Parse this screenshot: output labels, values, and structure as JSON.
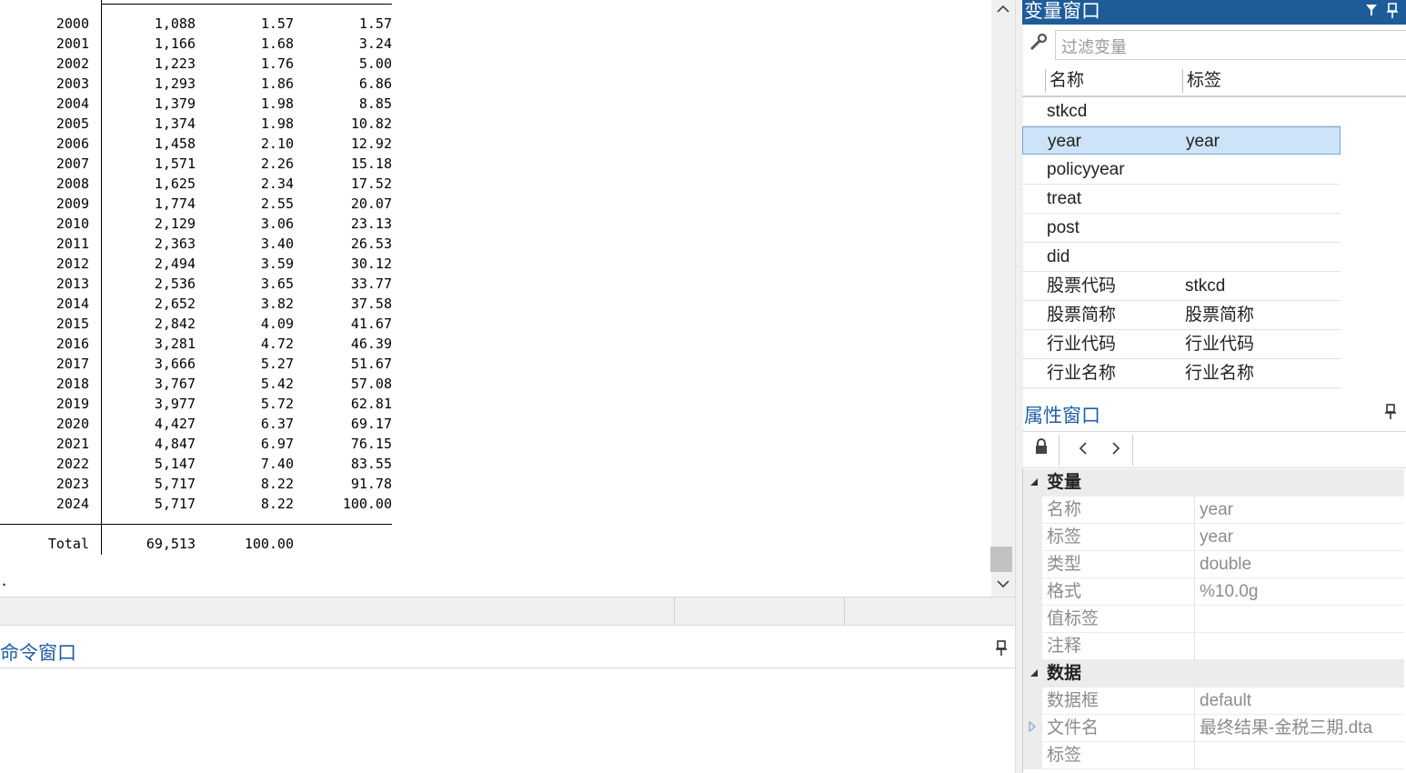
{
  "results": {
    "rows": [
      {
        "year": "2000",
        "freq": "1,088",
        "percent": "1.57",
        "cum": "1.57"
      },
      {
        "year": "2001",
        "freq": "1,166",
        "percent": "1.68",
        "cum": "3.24"
      },
      {
        "year": "2002",
        "freq": "1,223",
        "percent": "1.76",
        "cum": "5.00"
      },
      {
        "year": "2003",
        "freq": "1,293",
        "percent": "1.86",
        "cum": "6.86"
      },
      {
        "year": "2004",
        "freq": "1,379",
        "percent": "1.98",
        "cum": "8.85"
      },
      {
        "year": "2005",
        "freq": "1,374",
        "percent": "1.98",
        "cum": "10.82"
      },
      {
        "year": "2006",
        "freq": "1,458",
        "percent": "2.10",
        "cum": "12.92"
      },
      {
        "year": "2007",
        "freq": "1,571",
        "percent": "2.26",
        "cum": "15.18"
      },
      {
        "year": "2008",
        "freq": "1,625",
        "percent": "2.34",
        "cum": "17.52"
      },
      {
        "year": "2009",
        "freq": "1,774",
        "percent": "2.55",
        "cum": "20.07"
      },
      {
        "year": "2010",
        "freq": "2,129",
        "percent": "3.06",
        "cum": "23.13"
      },
      {
        "year": "2011",
        "freq": "2,363",
        "percent": "3.40",
        "cum": "26.53"
      },
      {
        "year": "2012",
        "freq": "2,494",
        "percent": "3.59",
        "cum": "30.12"
      },
      {
        "year": "2013",
        "freq": "2,536",
        "percent": "3.65",
        "cum": "33.77"
      },
      {
        "year": "2014",
        "freq": "2,652",
        "percent": "3.82",
        "cum": "37.58"
      },
      {
        "year": "2015",
        "freq": "2,842",
        "percent": "4.09",
        "cum": "41.67"
      },
      {
        "year": "2016",
        "freq": "3,281",
        "percent": "4.72",
        "cum": "46.39"
      },
      {
        "year": "2017",
        "freq": "3,666",
        "percent": "5.27",
        "cum": "51.67"
      },
      {
        "year": "2018",
        "freq": "3,767",
        "percent": "5.42",
        "cum": "57.08"
      },
      {
        "year": "2019",
        "freq": "3,977",
        "percent": "5.72",
        "cum": "62.81"
      },
      {
        "year": "2020",
        "freq": "4,427",
        "percent": "6.37",
        "cum": "69.17"
      },
      {
        "year": "2021",
        "freq": "4,847",
        "percent": "6.97",
        "cum": "76.15"
      },
      {
        "year": "2022",
        "freq": "5,147",
        "percent": "7.40",
        "cum": "83.55"
      },
      {
        "year": "2023",
        "freq": "5,717",
        "percent": "8.22",
        "cum": "91.78"
      },
      {
        "year": "2024",
        "freq": "5,717",
        "percent": "8.22",
        "cum": "100.00"
      }
    ],
    "total": {
      "label": "Total",
      "freq": "69,513",
      "percent": "100.00"
    },
    "prompt": "."
  },
  "command_window": {
    "title": "命令窗口"
  },
  "variables_window": {
    "title": "变量窗口",
    "filter_placeholder": "过滤变量",
    "columns": {
      "name": "名称",
      "label": "标签"
    },
    "variables": [
      {
        "name": "stkcd",
        "label": ""
      },
      {
        "name": "year",
        "label": "year",
        "selected": true
      },
      {
        "name": "policyyear",
        "label": ""
      },
      {
        "name": "treat",
        "label": ""
      },
      {
        "name": "post",
        "label": ""
      },
      {
        "name": "did",
        "label": ""
      },
      {
        "name": "股票代码",
        "label": "stkcd"
      },
      {
        "name": "股票简称",
        "label": "股票简称"
      },
      {
        "name": "行业代码",
        "label": "行业代码"
      },
      {
        "name": "行业名称",
        "label": "行业名称"
      }
    ]
  },
  "properties_window": {
    "title": "属性窗口",
    "sections": [
      {
        "label": "变量",
        "rows": [
          {
            "key": "名称",
            "value": "year"
          },
          {
            "key": "标签",
            "value": "year"
          },
          {
            "key": "类型",
            "value": "double"
          },
          {
            "key": "格式",
            "value": "%10.0g"
          },
          {
            "key": "值标签",
            "value": ""
          },
          {
            "key": "注释",
            "value": ""
          }
        ]
      },
      {
        "label": "数据",
        "rows": [
          {
            "key": "数据框",
            "value": "default"
          },
          {
            "key": "文件名",
            "value": "最终结果-金税三期.dta"
          },
          {
            "key": "标签",
            "value": ""
          }
        ]
      }
    ]
  },
  "icons": {
    "scroll_up": "chevron-up-icon",
    "scroll_down": "chevron-down-icon",
    "pin": "pin-icon",
    "filter": "filter-icon",
    "wrench": "wrench-icon",
    "lock": "lock-icon",
    "back": "chevron-left-icon",
    "forward": "chevron-right-icon",
    "collapse": "triangle-collapse-icon"
  },
  "colors": {
    "title_bar": "#1e5c99",
    "title_text": "#1f5fa6",
    "selection": "#cde3f7"
  }
}
